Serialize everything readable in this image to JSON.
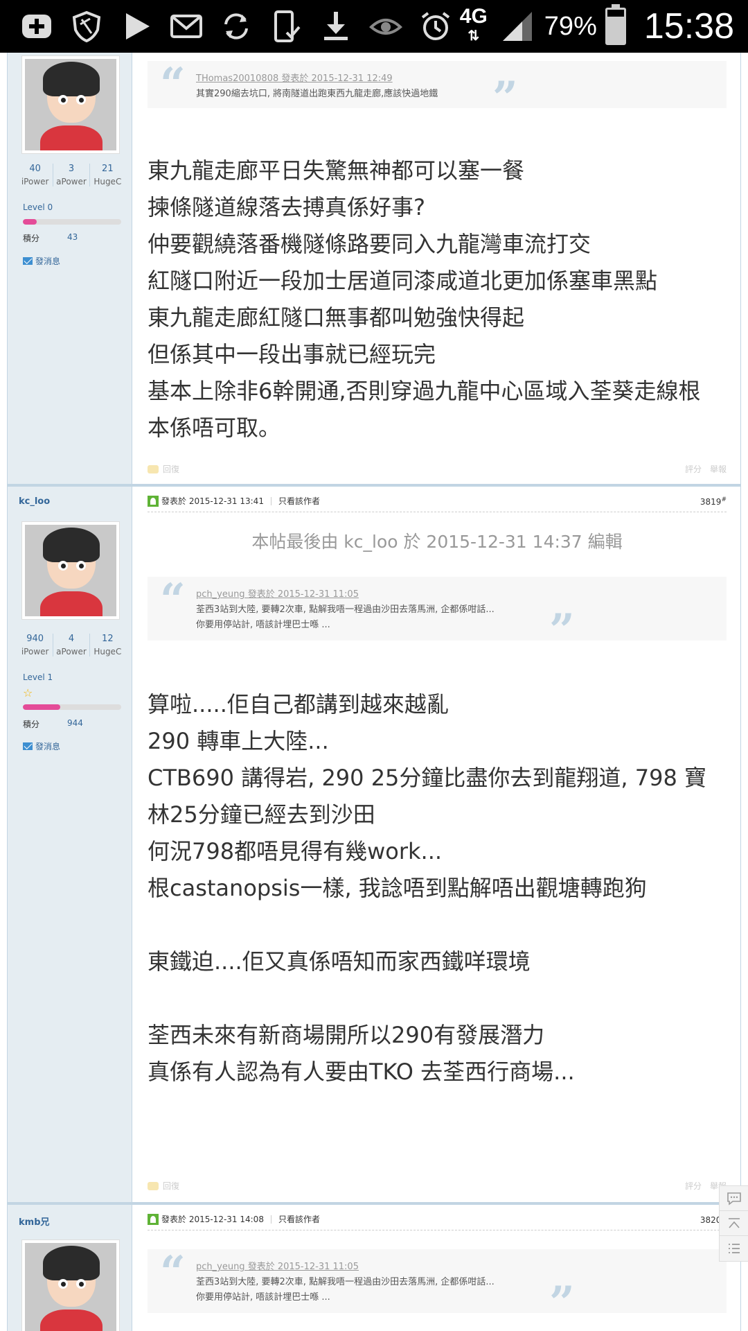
{
  "statusbar": {
    "network": "4G",
    "battery_pct": "79%",
    "battery_level": 0.79,
    "time": "15:38",
    "icons": [
      "add-icon",
      "shield-icon",
      "play-icon",
      "mail-icon",
      "sync-icon",
      "phone-check-icon",
      "download-icon",
      "eye-icon",
      "alarm-icon",
      "network-4g-icon",
      "signal-icon",
      "battery-icon"
    ]
  },
  "posts": [
    {
      "author": "",
      "stats": [
        {
          "num": "40",
          "label": "iPower"
        },
        {
          "num": "3",
          "label": "aPower"
        },
        {
          "num": "21",
          "label": "HugeC"
        }
      ],
      "level": "Level 0",
      "level_progress": 0.14,
      "points_label": "積分",
      "points": "43",
      "message_label": "發消息",
      "quote": {
        "author": "THomas20010808 發表於 2015-12-31 12:49",
        "lines": [
          "其實290縮去坑口, 將南隧道出跑東西九龍走廊,應該快過地鐵"
        ]
      },
      "body": [
        "東九龍走廊平日失驚無神都可以塞一餐",
        "揀條隧道線落去搏真係好事?",
        "仲要觀繞落番機隧條路要同入九龍灣車流打交",
        "紅隧口附近一段加士居道同漆咸道北更加係塞車黑點",
        "東九龍走廊紅隧口無事都叫勉強快得起",
        "但係其中一段出事就已經玩完",
        "基本上除非6幹開通,否則穿過九龍中心區域入荃葵走線根",
        "本係唔可取。"
      ],
      "reply_label": "回復",
      "rate_label": "評分",
      "report_label": "舉報"
    },
    {
      "author": "kc_loo",
      "stats": [
        {
          "num": "940",
          "label": "iPower"
        },
        {
          "num": "4",
          "label": "aPower"
        },
        {
          "num": "12",
          "label": "HugeC"
        }
      ],
      "level": "Level 1",
      "level_progress": 0.38,
      "points_label": "積分",
      "points": "944",
      "message_label": "發消息",
      "posted": "發表於 2015-12-31 13:41",
      "author_only": "只看該作者",
      "post_no": "3819",
      "post_no_suffix": "#",
      "edited_note": "本帖最後由 kc_loo 於 2015-12-31 14:37 編輯",
      "quote": {
        "author": "pch_yeung 發表於 2015-12-31 11:05",
        "lines": [
          "荃西3站到大陸, 要轉2次車, 點解我唔一程過由沙田去落馬洲, 企都係咁話...",
          "你要用停站計, 唔該計埋巴士喺 ..."
        ]
      },
      "body": [
        "算啦.....佢自己都講到越來越亂",
        "290 轉車上大陸...",
        "CTB690 講得岩, 290 25分鐘比盡你去到龍翔道, 798 寶",
        "林25分鐘已經去到沙田",
        "何況798都唔見得有幾work...",
        "根castanopsis一樣, 我諗唔到點解唔出觀塘轉跑狗",
        "",
        "東鐵迫....佢又真係唔知而家西鐵咩環境",
        "",
        "荃西未來有新商場開所以290有發展潛力",
        "真係有人認為有人要由TKO 去荃西行商場..."
      ],
      "reply_label": "回復",
      "rate_label": "評分",
      "report_label": "舉報"
    },
    {
      "author": "kmb兄",
      "posted": "發表於 2015-12-31 14:08",
      "author_only": "只看該作者",
      "post_no": "3820",
      "post_no_suffix": "#",
      "quote": {
        "author": "pch_yeung 發表於 2015-12-31 11:05",
        "lines": [
          "荃西3站到大陸, 要轉2次車, 點解我唔一程過由沙田去落馬洲, 企都係咁話...",
          "你要用停站計, 唔該計埋巴士喺 ..."
        ]
      }
    }
  ],
  "floatbar": [
    "comment-icon",
    "back-to-top-icon",
    "list-icon"
  ]
}
